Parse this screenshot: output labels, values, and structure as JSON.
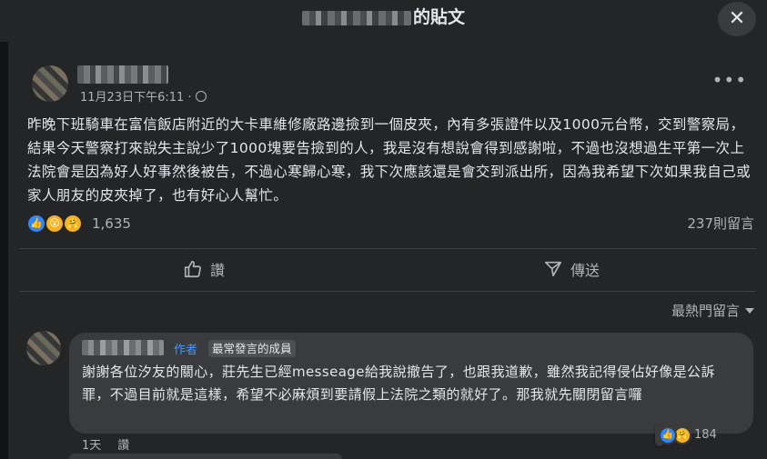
{
  "header": {
    "title_suffix": "的貼文",
    "close_icon": "close-icon"
  },
  "post": {
    "timestamp": "11月23日下午6:11 ·",
    "privacy_icon": "globe-icon",
    "more_label": "•••",
    "text": "昨晚下班騎車在富信飯店附近的大卡車維修廠路邊撿到一個皮夾，內有多張證件以及1000元台幣，交到警察局，結果今天警察打來說失主說少了1000塊要告撿到的人，我是沒有想說會得到感謝啦，不過也沒想過生平第一次上法院會是因為好人好事然後被告，不過心寒歸心寒，我下次應該還是會交到派出所，因為我希望下次如果我自己或家人朋友的皮夾掉了，也有好心人幫忙。",
    "reaction_count": "1,635",
    "reaction_icons": [
      "like-icon",
      "wow-icon",
      "care-icon"
    ],
    "comment_count": "237則留言"
  },
  "actions": {
    "like_label": "讚",
    "share_label": "傳送"
  },
  "comments": {
    "sort_label": "最熱門留言",
    "items": [
      {
        "author_tag": "作者",
        "badge": "最常發言的成員",
        "text": "謝謝各位汐友的關心，莊先生已經messeage給我說撤告了，也跟我道歉，雖然我記得侵佔好像是公訴罪，不過目前就是這樣，希望不必麻煩到要請假上法院之類的就好了。那我就先關閉留言囉",
        "reaction_count": "184",
        "time": "1天",
        "like_label": "讚"
      }
    ]
  },
  "colors": {
    "background": "#242526",
    "text": "#e4e6eb",
    "muted": "#b0b3b8",
    "accent": "#4599ff",
    "like": "#2d88ff"
  }
}
